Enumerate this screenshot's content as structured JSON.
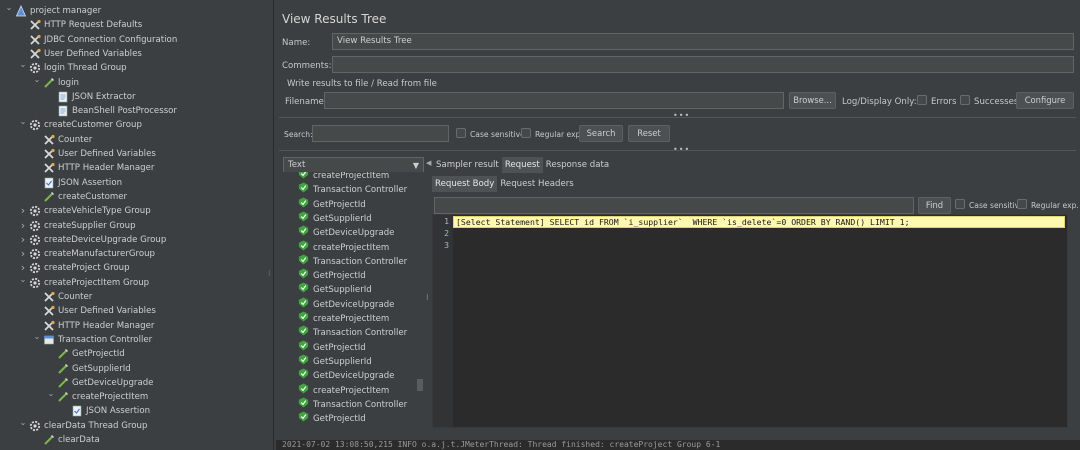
{
  "tree": {
    "items": [
      {
        "label": "project manager",
        "icon": "testplan-icon",
        "arrow": "v"
      },
      {
        "label": "HTTP Request Defaults",
        "icon": "config-element-icon",
        "arrow": ""
      },
      {
        "label": "JDBC Connection Configuration",
        "icon": "config-element-icon",
        "arrow": ""
      },
      {
        "label": "User Defined Variables",
        "icon": "config-element-icon",
        "arrow": ""
      },
      {
        "label": "login Thread Group",
        "icon": "thread-group-icon",
        "arrow": "v"
      },
      {
        "label": "login",
        "icon": "sampler-icon",
        "arrow": "v"
      },
      {
        "label": "JSON Extractor",
        "icon": "post-processor-icon",
        "arrow": ""
      },
      {
        "label": "BeanShell PostProcessor",
        "icon": "post-processor-icon",
        "arrow": ""
      },
      {
        "label": "createCustomer Group",
        "icon": "thread-group-icon",
        "arrow": "v"
      },
      {
        "label": "Counter",
        "icon": "config-element-icon",
        "arrow": ""
      },
      {
        "label": "User Defined Variables",
        "icon": "config-element-icon",
        "arrow": ""
      },
      {
        "label": "HTTP Header Manager",
        "icon": "config-element-icon",
        "arrow": ""
      },
      {
        "label": "JSON Assertion",
        "icon": "assertion-icon",
        "arrow": ""
      },
      {
        "label": "createCustomer",
        "icon": "sampler-icon",
        "arrow": ""
      },
      {
        "label": "createVehicleType Group",
        "icon": "thread-group-icon",
        "arrow": ">"
      },
      {
        "label": "createSupplier Group",
        "icon": "thread-group-icon",
        "arrow": ">"
      },
      {
        "label": "createDeviceUpgrade Group",
        "icon": "thread-group-icon",
        "arrow": ">"
      },
      {
        "label": "createManufacturerGroup",
        "icon": "thread-group-icon",
        "arrow": ">"
      },
      {
        "label": "createProject Group",
        "icon": "thread-group-icon",
        "arrow": ">"
      },
      {
        "label": "createProjectItem Group",
        "icon": "thread-group-icon",
        "arrow": "v"
      },
      {
        "label": "Counter",
        "icon": "config-element-icon",
        "arrow": ""
      },
      {
        "label": "User Defined Variables",
        "icon": "config-element-icon",
        "arrow": ""
      },
      {
        "label": "HTTP Header Manager",
        "icon": "config-element-icon",
        "arrow": ""
      },
      {
        "label": "Transaction Controller",
        "icon": "controller-icon",
        "arrow": "v"
      },
      {
        "label": "GetProjectId",
        "icon": "sampler-icon",
        "arrow": ""
      },
      {
        "label": "GetSupplierId",
        "icon": "sampler-icon",
        "arrow": ""
      },
      {
        "label": "GetDeviceUpgrade",
        "icon": "sampler-icon",
        "arrow": ""
      },
      {
        "label": "createProjectItem",
        "icon": "sampler-icon",
        "arrow": "v"
      },
      {
        "label": "JSON Assertion",
        "icon": "assertion-icon",
        "arrow": ""
      },
      {
        "label": "clearData Thread Group",
        "icon": "thread-group-icon",
        "arrow": "v"
      },
      {
        "label": "clearData",
        "icon": "sampler-icon",
        "arrow": ""
      }
    ]
  },
  "panel": {
    "title": "View Results Tree",
    "name_label": "Name:",
    "name_value": "View Results Tree",
    "comments_label": "Comments:",
    "comments_value": "",
    "write_group_label": "Write results to file / Read from file",
    "filename_label": "Filename",
    "filename_value": "",
    "browse_label": "Browse...",
    "log_display_label": "Log/Display Only:",
    "errors_label": "Errors",
    "successes_label": "Successes",
    "configure_label": "Configure"
  },
  "search": {
    "label": "Search:",
    "value": "",
    "case_sensitive_label": "Case sensitive",
    "regular_exp_label": "Regular exp.",
    "search_button": "Search",
    "reset_button": "Reset"
  },
  "renderer": {
    "selected": "Text"
  },
  "samplers": [
    "createProjectItem",
    "Transaction Controller",
    "GetProjectId",
    "GetSupplierId",
    "GetDeviceUpgrade",
    "createProjectItem",
    "Transaction Controller",
    "GetProjectId",
    "GetSupplierId",
    "GetDeviceUpgrade",
    "createProjectItem",
    "Transaction Controller",
    "GetProjectId",
    "GetSupplierId",
    "GetDeviceUpgrade",
    "createProjectItem",
    "Transaction Controller",
    "GetProjectId"
  ],
  "result_tabs": {
    "sampler_result": "Sampler result",
    "request": "Request",
    "response_data": "Response data",
    "request_body": "Request Body",
    "request_headers": "Request Headers"
  },
  "find": {
    "value": "",
    "find_button": "Find",
    "case_sensitive_label": "Case sensitive",
    "regular_exp_label": "Regular exp."
  },
  "editor": {
    "line_numbers": [
      "1",
      "2",
      "3"
    ],
    "line1": "[Select Statement] SELECT id FROM `i_supplier`  WHERE `is_delete`=0 ORDER BY RAND() LIMIT 1;"
  },
  "status_text": "2021-07-02 13:08:50,215 INFO o.a.j.t.JMeterThread: Thread finished: createProject Group 6-1",
  "colors": {
    "background": "#3c3f41",
    "editor_bg": "#2b2b2b",
    "highlight_line": "#fff8b0",
    "success_icon": "#3fa33f"
  }
}
